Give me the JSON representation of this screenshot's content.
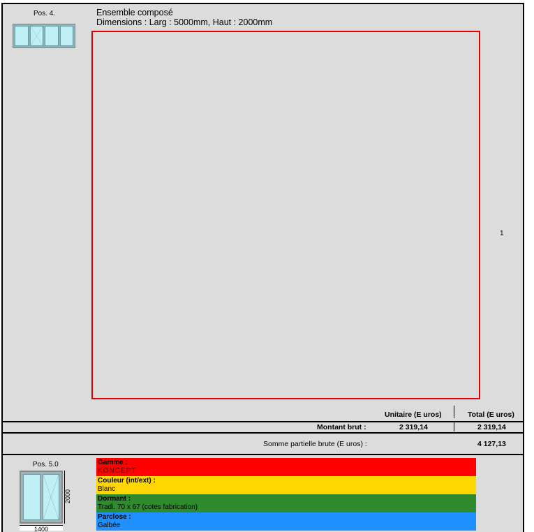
{
  "item_4": {
    "pos_label": "Pos. 4.",
    "title": "Ensemble composé",
    "dimensions": "Dimensions : Larg : 5000mm, Haut : 2000mm",
    "quantity": "1"
  },
  "pricing": {
    "unit_header": "Unitaire (E uros)",
    "total_header": "Total (E uros)",
    "gross_label": "Montant brut :",
    "gross_unit": "2 319,14",
    "gross_total": "2 319,14",
    "subtotal_label": "Somme partielle brute (E uros) :",
    "subtotal_value": "4 127,13"
  },
  "item_5": {
    "pos_label": "Pos. 5.0",
    "height_dim": "2000",
    "width_dim": "1400",
    "specs": [
      {
        "key": "Gamme :",
        "value": "KONCEPT",
        "color": "#ff0000"
      },
      {
        "key": "Couleur (int/ext) :",
        "value": "Blanc",
        "color": "#ffd700"
      },
      {
        "key": "Dormant :",
        "value": "Tradi. 70 x 67 (cotes fabrication)",
        "color": "#2e8b2e"
      },
      {
        "key": "Parclose :",
        "value": "Galbée",
        "color": "#1e90ff"
      }
    ]
  }
}
